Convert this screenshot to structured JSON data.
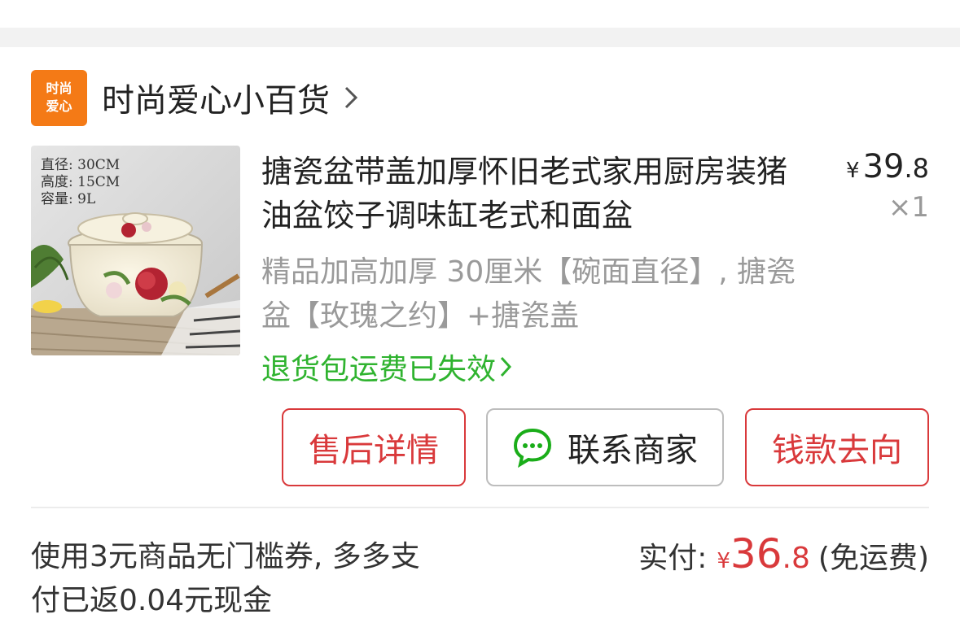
{
  "shop": {
    "logo_text": "时尚爱心",
    "name": "时尚爱心小百货"
  },
  "product": {
    "image_spec_lines": [
      "直径: 30CM",
      "高度: 15CM",
      "容量: 9L"
    ],
    "title": "搪瓷盆带盖加厚怀旧老式家用厨房装猪油盆饺子调味缸老式和面盆",
    "price_currency": "¥",
    "price_integer": "39",
    "price_decimal": ".8",
    "quantity": "×1",
    "variant": "精品加高加厚 30厘米【碗面直径】, 搪瓷盆【玫瑰之约】+搪瓷盖",
    "refund_shipping_status": "退货包运费已失效"
  },
  "actions": {
    "after_sale": "售后详情",
    "contact_seller": "联系商家",
    "money_flow": "钱款去向"
  },
  "summary": {
    "coupon_note": "使用3元商品无门槛券, 多多支付已返0.04元现金",
    "paid_label": "实付:",
    "paid_currency": "¥",
    "paid_integer": "36",
    "paid_decimal": ".8",
    "shipping_note": "(免运费)"
  },
  "colors": {
    "accent_red": "#d9393b",
    "link_green": "#2fb32f",
    "logo_orange": "#f47a16",
    "wechat_green": "#1aad19"
  },
  "icons": {
    "shop_chevron": "chevron-right-icon",
    "refund_chevron": "chevron-right-icon",
    "contact": "chat-bubble-icon"
  }
}
